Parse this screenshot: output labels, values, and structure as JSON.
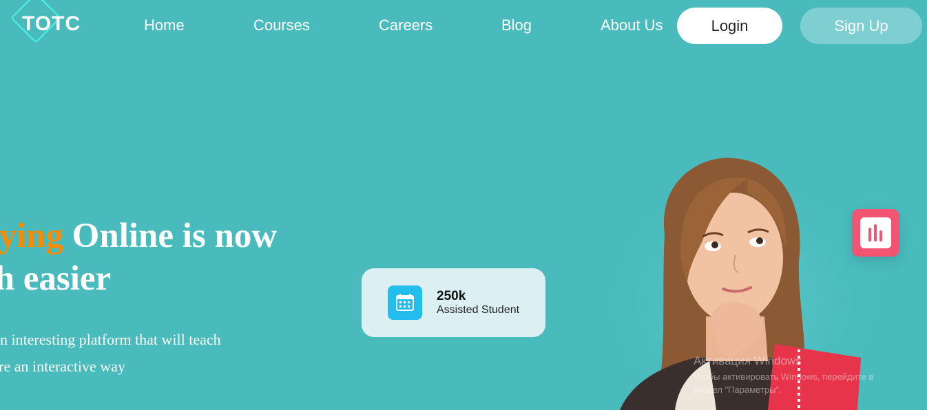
{
  "header": {
    "logo_text": "TOTC",
    "nav": [
      {
        "label": "Home"
      },
      {
        "label": "Courses"
      },
      {
        "label": "Careers"
      },
      {
        "label": "Blog"
      },
      {
        "label": "About Us"
      }
    ],
    "login_label": "Login",
    "signup_label": "Sign Up"
  },
  "hero": {
    "headline_accent": "dying",
    "headline_rest_line1": " Online is now",
    "headline_line2": "ch easier",
    "subtext_line1": "is an interesting platform that will teach",
    "subtext_line2": "more an interactive way"
  },
  "stat_card": {
    "icon": "calendar-icon",
    "value": "250k",
    "label": "Assisted Student"
  },
  "chart_badge": {
    "icon": "bar-chart-icon"
  },
  "watermark": {
    "title": "Активация Windows",
    "line1": "Чтобы активировать Windows, перейдите в",
    "line2": "раздел \"Параметры\"."
  },
  "colors": {
    "background": "#49BBBD",
    "accent": "#F48C06",
    "stat_card_bg": "#DDF0F1",
    "calendar_icon_bg": "#23BDEE",
    "chart_badge_bg": "#F25471",
    "signup_bg": "#7DCFD1"
  }
}
